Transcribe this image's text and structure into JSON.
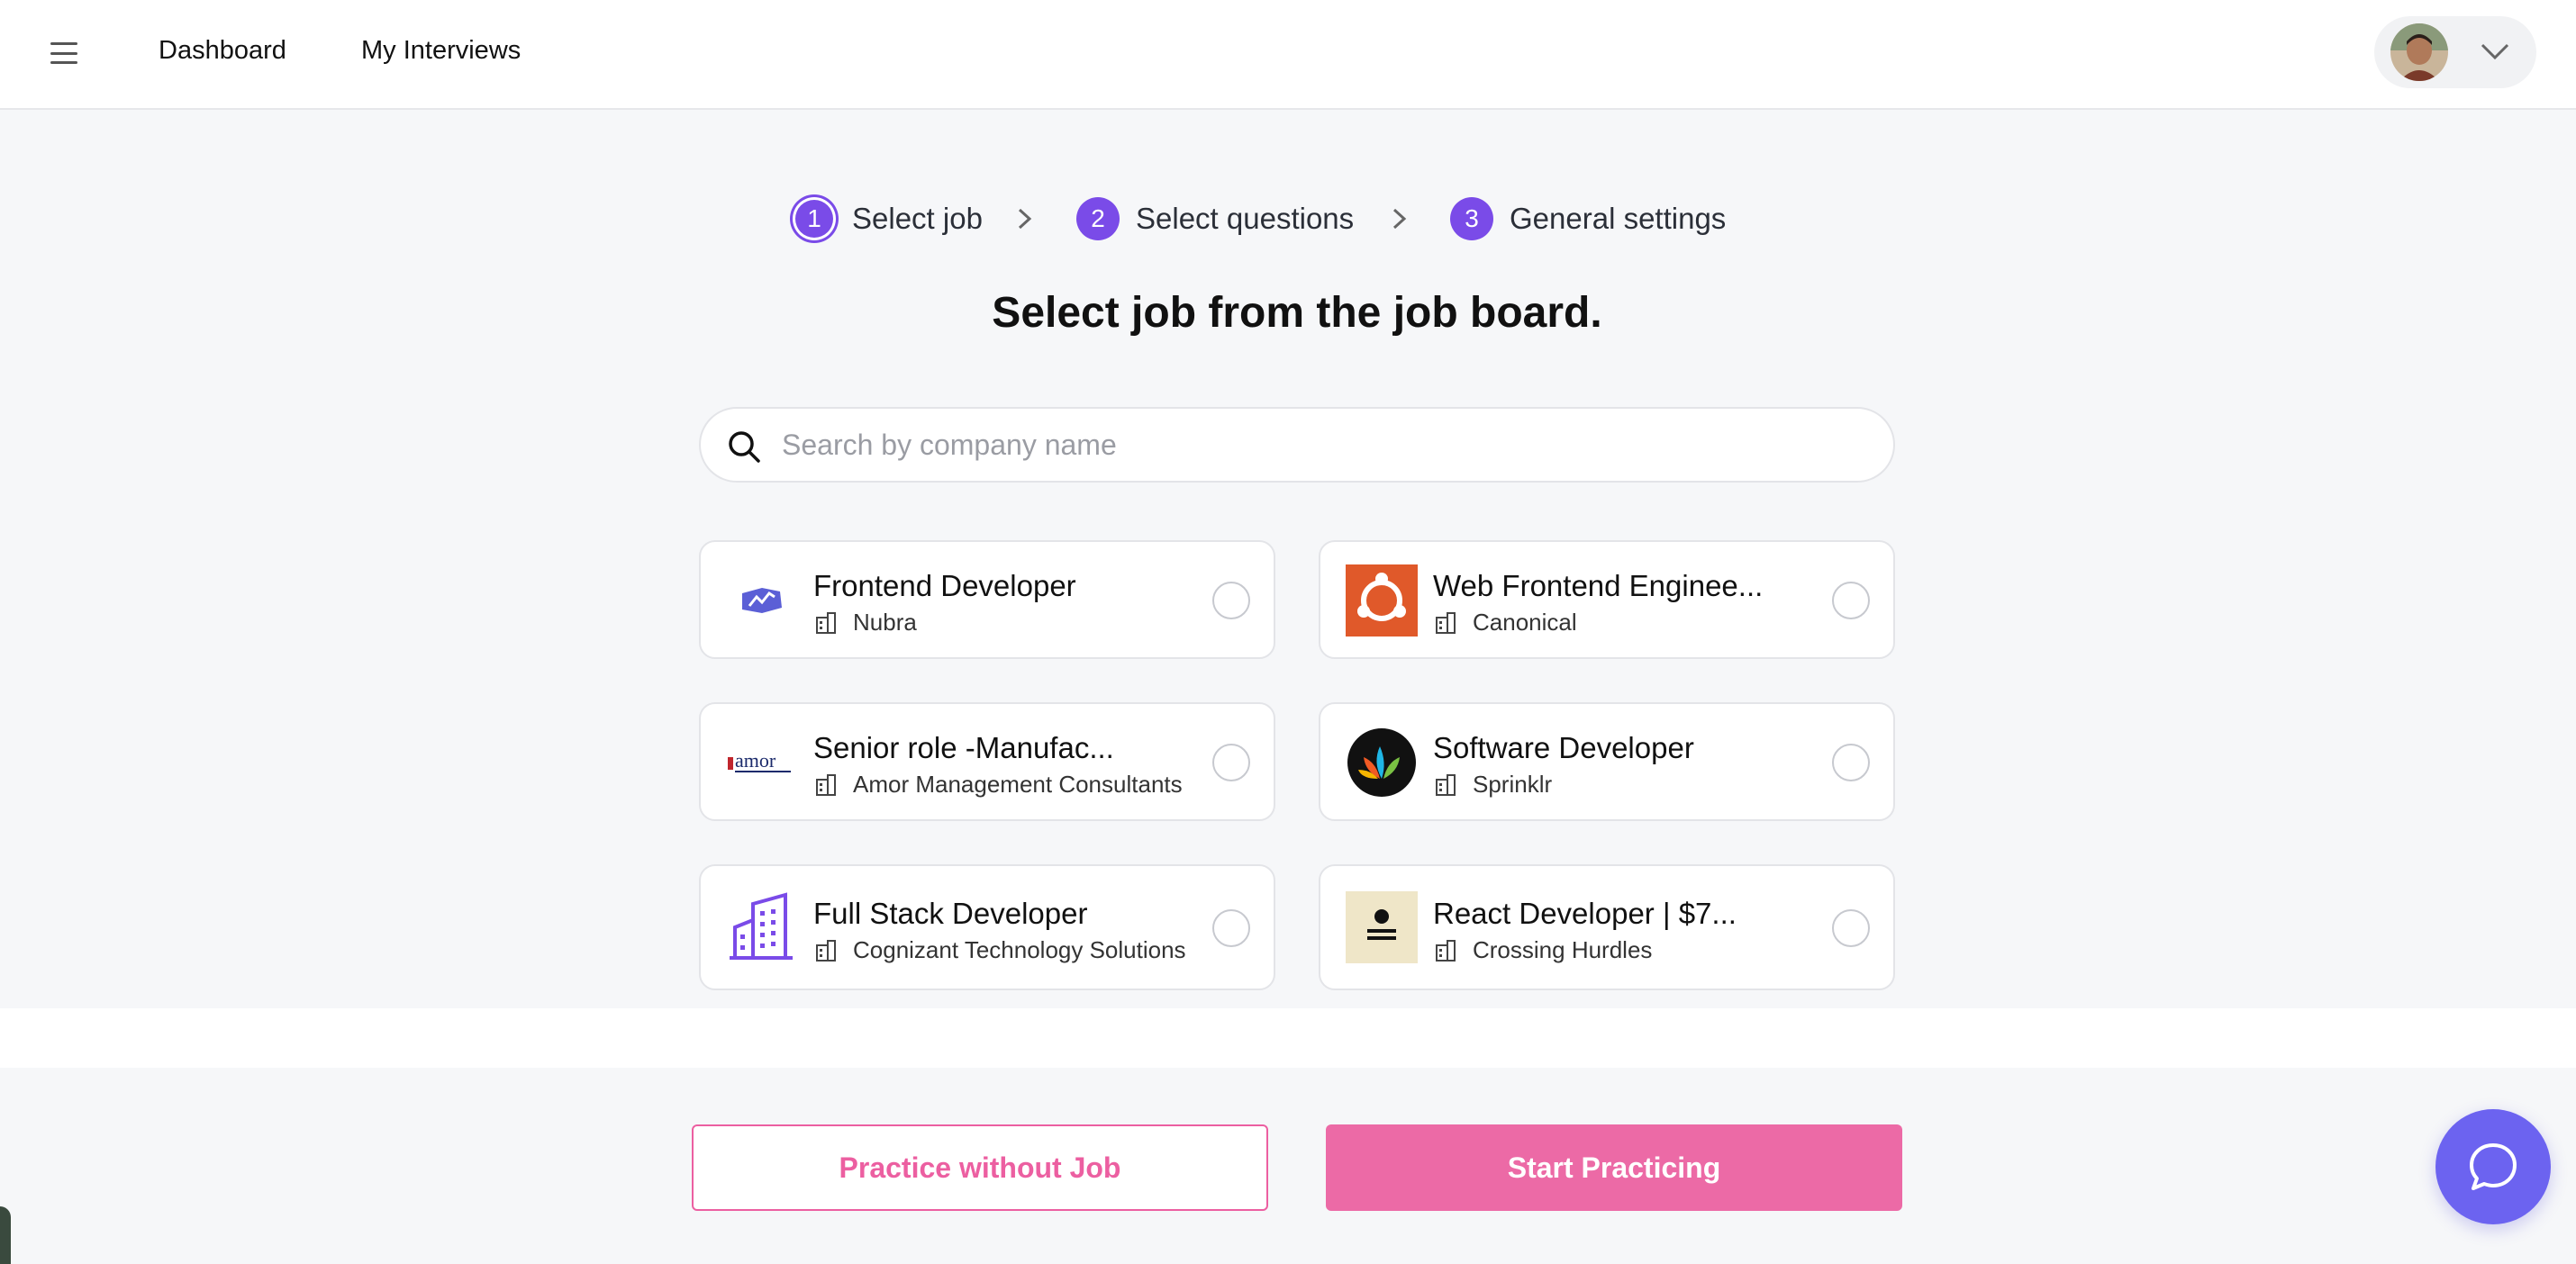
{
  "nav": {
    "menu_icon": "hamburger-icon",
    "links": [
      "Dashboard",
      "My Interviews"
    ],
    "profile_chevron_icon": "chevron-down-icon"
  },
  "stepper": {
    "steps": [
      {
        "num": "1",
        "label": "Select job"
      },
      {
        "num": "2",
        "label": "Select questions"
      },
      {
        "num": "3",
        "label": "General settings"
      }
    ],
    "accent_color": "#7a4be8"
  },
  "heading": "Select job from the job board.",
  "search": {
    "placeholder": "Search by company name",
    "value": ""
  },
  "jobs": [
    {
      "title": "Frontend Developer",
      "company": "Nubra",
      "logo": "nubra-logo",
      "selected": false
    },
    {
      "title": "Web Frontend Enginee...",
      "company": "Canonical",
      "logo": "canonical-logo",
      "selected": false
    },
    {
      "title": "Senior role -Manufac...",
      "company": "Amor Management Consultants",
      "logo": "amor-logo",
      "logo_text": "amor",
      "selected": false
    },
    {
      "title": "Software Developer",
      "company": "Sprinklr",
      "logo": "sprinklr-logo",
      "selected": false
    },
    {
      "title": "Full Stack Developer",
      "company": "Cognizant Technology Solutions",
      "logo": "building-logo",
      "selected": false
    },
    {
      "title": "React Developer | $7...",
      "company": "Crossing Hurdles",
      "logo": "crossing-hurdles-logo",
      "selected": false
    }
  ],
  "footer": {
    "secondary_label": "Practice without Job",
    "primary_label": "Start Practicing",
    "primary_color": "#ec6aa6",
    "chat_icon": "chat-bubble-icon"
  }
}
